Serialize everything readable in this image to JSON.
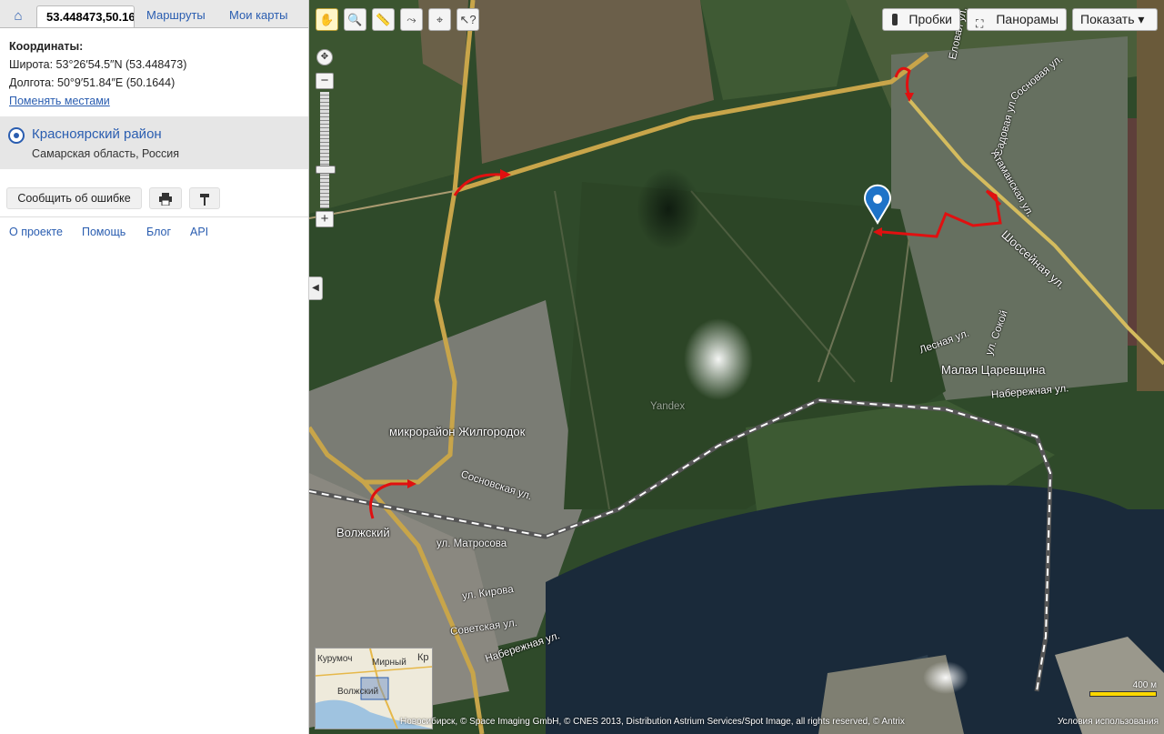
{
  "tabs": {
    "home_icon": "home-icon",
    "coords_value": "53.448473,50.16",
    "routes": "Маршруты",
    "my_maps": "Мои карты"
  },
  "coords": {
    "heading": "Координаты:",
    "lat": "Широта: 53°26′54.5″N (53.448473)",
    "lon": "Долгота: 50°9′51.84″E (50.1644)",
    "swap_link": "Поменять местами"
  },
  "place": {
    "name": "Красноярский район",
    "region": "Самарская область, Россия"
  },
  "actions": {
    "report_error": "Сообщить об ошибке",
    "print_icon": "printer-icon",
    "pin_icon": "pushpin-icon"
  },
  "footer": {
    "about": "О проекте",
    "help": "Помощь",
    "blog": "Блог",
    "api": "API"
  },
  "map_controls": {
    "tools": [
      "hand-icon",
      "magnifier-icon",
      "ruler-icon",
      "route-icon",
      "placemark-icon",
      "cursor-question-icon"
    ],
    "traffic": "Пробки",
    "panoramas": "Панорамы",
    "show": "Показать ▾",
    "collapse": "◀"
  },
  "map_labels": {
    "elovaya": "Еловая ул.",
    "sosnovaya_top": "Сосновая ул.",
    "sadovaya": "Садовая ул.",
    "atamanskaya": "Атаманская ул.",
    "shosseynaya": "Шоссейная ул.",
    "sokoly": "ул. Сокой",
    "lesnaya": "Лесная ул.",
    "malaya": "Малая Царевщина",
    "naberezhnaya_east": "Набережная ул.",
    "yandex_wm": "Yandex",
    "mikrorayon": "микрорайон Жилгородок",
    "sosnovskaya": "Сосновская ул.",
    "volzhsky": "Волжский",
    "matrosova": "ул. Матросова",
    "kirova": "ул. Кирова",
    "sovetskaya": "Советская ул.",
    "naberezhnaya_west": "Набережная ул."
  },
  "minimap": {
    "kurumoch": "Курумоч",
    "mirny": "Мирный",
    "kr": "Кр",
    "volzhsky": "Волжский"
  },
  "scale": "400 м",
  "copyright": "Новосибирск, © Space Imaging GmbH, © CNES 2013, Distribution Astrium Services/Spot Image, all rights reserved, © Antrix",
  "terms": "Условия использования"
}
